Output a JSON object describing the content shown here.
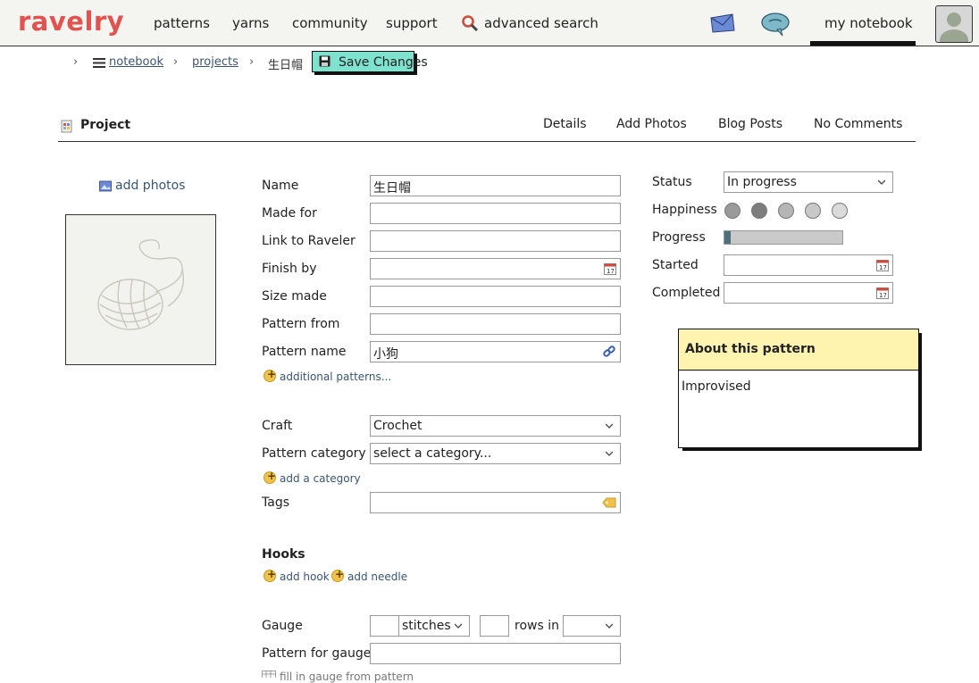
{
  "nav": {
    "logo": "ravelry",
    "links": [
      "patterns",
      "yarns",
      "community",
      "support"
    ],
    "advanced_search": "advanced search",
    "my_notebook": "my notebook"
  },
  "breadcrumb": {
    "items": [
      "notebook",
      "projects"
    ],
    "current": "生日帽",
    "save_label": "Save Changes"
  },
  "project": {
    "title": "Project",
    "tabs": [
      "Details",
      "Add Photos",
      "Blog Posts",
      "No Comments"
    ]
  },
  "photos": {
    "add_label": "add photos"
  },
  "form": {
    "name_label": "Name",
    "name_value": "生日帽",
    "made_for_label": "Made for",
    "link_label": "Link to Raveler",
    "finish_by_label": "Finish by",
    "size_made_label": "Size made",
    "pattern_from_label": "Pattern from",
    "pattern_name_label": "Pattern name",
    "pattern_name_value": "小狗",
    "additional_patterns": "additional patterns...",
    "craft_label": "Craft",
    "craft_value": "Crochet",
    "category_label": "Pattern category",
    "category_value": "select a category...",
    "add_category": "add a category",
    "tags_label": "Tags",
    "hooks_heading": "Hooks",
    "add_hook": "add hook",
    "add_needle": "add needle",
    "gauge_label": "Gauge",
    "gauge_unit": "stitches",
    "rows_in": "rows in",
    "pattern_for_gauge_label": "Pattern for gauge",
    "fill_gauge": "fill in gauge from pattern"
  },
  "status": {
    "status_label": "Status",
    "status_value": "In progress",
    "happiness_label": "Happiness",
    "progress_label": "Progress",
    "progress_fraction": 0.05,
    "started_label": "Started",
    "completed_label": "Completed"
  },
  "about": {
    "heading": "About this pattern",
    "text": "Improvised"
  },
  "colors": {
    "brand": "#e2524f",
    "save_button": "#7ee2cf",
    "about_header": "#fff3b0",
    "link": "#3a5572"
  }
}
